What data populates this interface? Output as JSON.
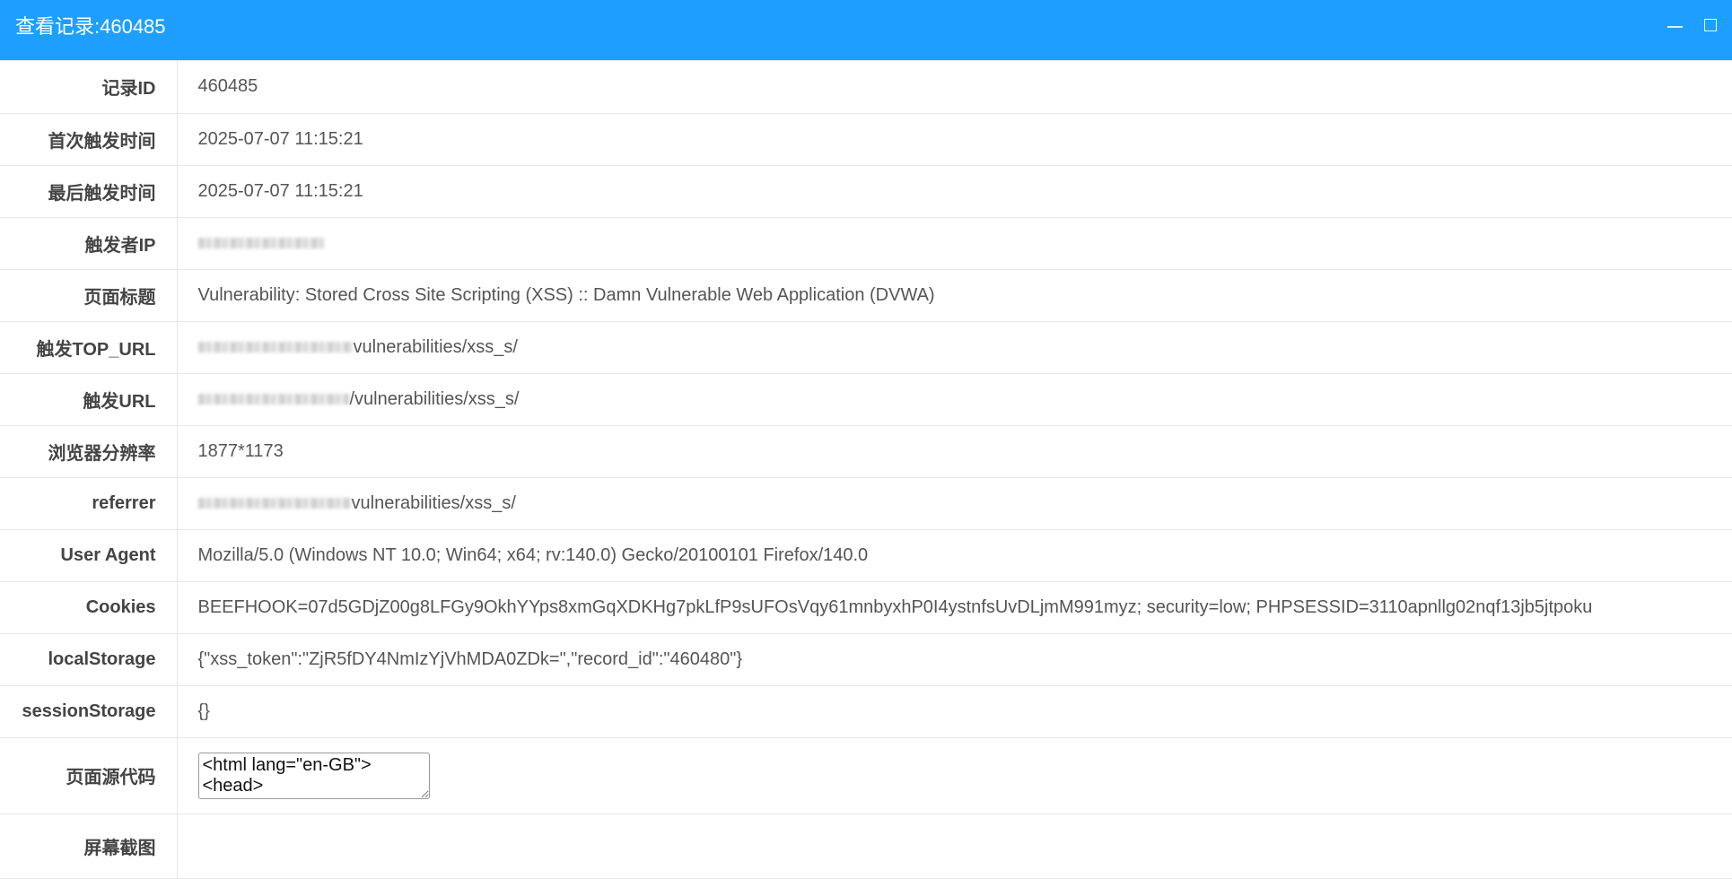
{
  "window": {
    "title": "查看记录:460485"
  },
  "records": {
    "record_id": {
      "label": "记录ID",
      "value": "460485"
    },
    "first_trigger": {
      "label": "首次触发时间",
      "value": "2025-07-07 11:15:21"
    },
    "last_trigger": {
      "label": "最后触发时间",
      "value": "2025-07-07 11:15:21"
    },
    "trigger_ip": {
      "label": "触发者IP",
      "value": ""
    },
    "page_title": {
      "label": "页面标题",
      "value": "Vulnerability: Stored Cross Site Scripting (XSS) :: Damn Vulnerable Web Application (DVWA)"
    },
    "top_url": {
      "label": "触发TOP_URL",
      "value": "vulnerabilities/xss_s/"
    },
    "trigger_url": {
      "label": "触发URL",
      "value": "/vulnerabilities/xss_s/"
    },
    "resolution": {
      "label": "浏览器分辨率",
      "value": "1877*1173"
    },
    "referrer": {
      "label": "referrer",
      "value": "vulnerabilities/xss_s/"
    },
    "user_agent": {
      "label": "User Agent",
      "value": "Mozilla/5.0 (Windows NT 10.0; Win64; x64; rv:140.0) Gecko/20100101 Firefox/140.0"
    },
    "cookies": {
      "label": "Cookies",
      "value": "BEEFHOOK=07d5GDjZ00g8LFGy9OkhYYps8xmGqXDKHg7pkLfP9sUFOsVqy61mnbyxhP0I4ystnfsUvDLjmM991myz; security=low; PHPSESSID=3110apnllg02nqf13jb5jtpoku"
    },
    "local_storage": {
      "label": "localStorage",
      "value": "{\"xss_token\":\"ZjR5fDY4NmIzYjVhMDA0ZDk=\",\"record_id\":\"460480\"}"
    },
    "session_storage": {
      "label": "sessionStorage",
      "value": "{}"
    },
    "page_source": {
      "label": "页面源代码",
      "value": "<html lang=\"en-GB\"><head>"
    },
    "screenshot": {
      "label": "屏幕截图",
      "value": ""
    }
  },
  "colors": {
    "titlebar": "#1e9fff",
    "border": "#e6e6e6",
    "label_text": "#444444",
    "value_text": "#555555"
  }
}
